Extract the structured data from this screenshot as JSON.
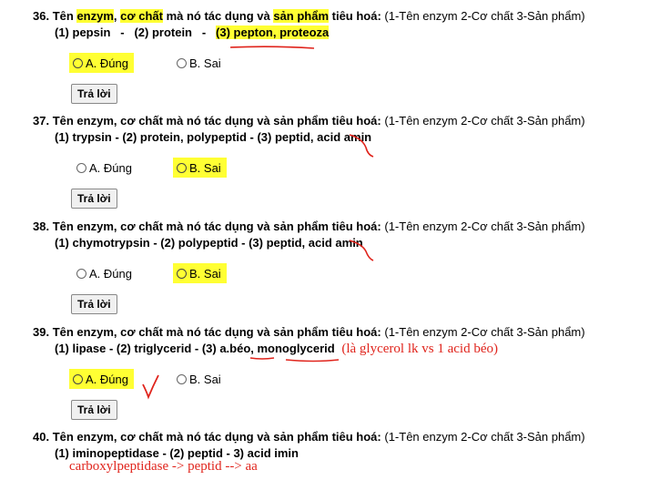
{
  "questions": [
    {
      "number": "36.",
      "stem_a": "Tên ",
      "stem_enzym": "enzym",
      "stem_sep": ", ",
      "stem_coChat": "cơ chất",
      "stem_mid": " mà nó tác dụng và ",
      "stem_sanPham": "sản phẩm",
      "stem_end": " tiêu hoá:",
      "hint": " (1-Tên enzym   2-Cơ chất   3-Sản phẩm)",
      "answer_parts": [
        "(1) pepsin",
        "-",
        "(2) protein",
        "-",
        "(3) pepton, proteoza"
      ],
      "option_a": "A. Đúng",
      "option_b": "B. Sai",
      "submit": "Trả lời"
    },
    {
      "number": "37.",
      "stem": "Tên enzym, cơ chất mà nó tác dụng và sản phẩm tiêu hoá:",
      "hint": " (1-Tên enzym   2-Cơ chất   3-Sản phẩm)",
      "answer_line": "(1) trypsin   -   (2) protein, polypeptid   -   (3) peptid, acid amin",
      "option_a": "A. Đúng",
      "option_b": "B. Sai",
      "submit": "Trả lời"
    },
    {
      "number": "38.",
      "stem": "Tên enzym, cơ chất mà nó tác dụng và sản phẩm tiêu hoá:",
      "hint": " (1-Tên enzym   2-Cơ chất   3-Sản phẩm)",
      "answer_line": "(1) chymotrypsin   -   (2) polypeptid   -   (3) peptid, acid amin",
      "option_a": "A. Đúng",
      "option_b": "B. Sai",
      "submit": "Trả lời"
    },
    {
      "number": "39.",
      "stem": "Tên enzym, cơ chất mà nó tác dụng và sản phẩm tiêu hoá:",
      "hint": " (1-Tên enzym   2-Cơ chất   3-Sản phẩm)",
      "answer_line": "(1) lipase   -   (2) triglycerid   -   (3) a.béo, monoglycerid",
      "note": "(là glycerol lk vs 1 acid béo)",
      "option_a": "A. Đúng",
      "option_b": "B. Sai",
      "submit": "Trả lời"
    },
    {
      "number": "40.",
      "stem": "Tên enzym, cơ chất mà nó tác dụng và sản phẩm tiêu hoá:",
      "hint": " (1-Tên enzym   2-Cơ chất   3-Sản phẩm)",
      "answer_line": "(1) iminopeptidase   -   (2) peptid   -   3) acid imin",
      "note": "carboxylpeptidase -> peptid --> aa"
    }
  ],
  "colors": {
    "highlight": "#ffff33",
    "annotation": "#e0241c"
  }
}
